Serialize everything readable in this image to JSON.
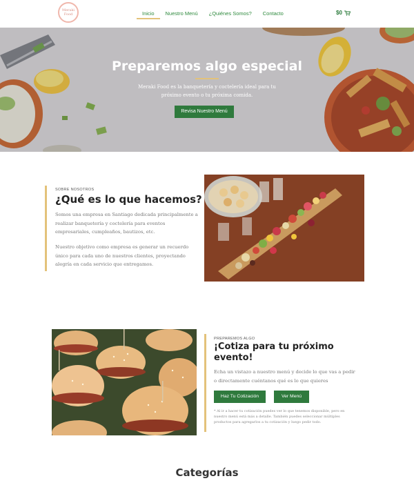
{
  "header": {
    "logo_line1": "Meraki",
    "logo_line2": "Food",
    "nav": [
      "Inicio",
      "Nuestro Menú",
      "¿Quiénes Somos?",
      "Contacto"
    ],
    "cart_total": "$0"
  },
  "hero": {
    "title": "Preparemos algo especial",
    "subtitle": "Meraki Food es la banquetería y coctelería ideal para tu próximo evento o tu próxima comida.",
    "button": "Revisa Nuestro Menú"
  },
  "about": {
    "eyebrow": "SOBRE NOSOTROS",
    "title": "¿Qué es lo que hacemos?",
    "p1": "Somos una empresa en Santiago dedicada principalmente a realizar banquetería y coctelería para eventos empresariales, cumpleaños, bautizos, etc.",
    "p2": "Nuestro objetivo como empresa es generar un recuerdo único para cada uno de nuestros clientes, proyectando alegría en cada servicio que entregamos."
  },
  "quote": {
    "eyebrow": "PREPAREMOS ALGO",
    "title": "¡Cotiza para tu próximo evento!",
    "paragraph": "Echa un vistazo a nuestro menú y decide lo que vas a pedir o directamente cuéntanos qué es lo que quieres",
    "btn_quote": "Haz Tu Cotización",
    "btn_menu": "Ver Menú",
    "note": "* Al ir a hacer tu cotización puedes ver lo que tenemos disponible, pero en nuestro menú está más a detalle. También puedes seleccionar múltiples productos para agregarlos a tu cotización y luego pedir todo."
  },
  "categories_title": "Categorías",
  "colors": {
    "accent_green": "#2f7a3d",
    "accent_gold": "#e3c27a"
  }
}
